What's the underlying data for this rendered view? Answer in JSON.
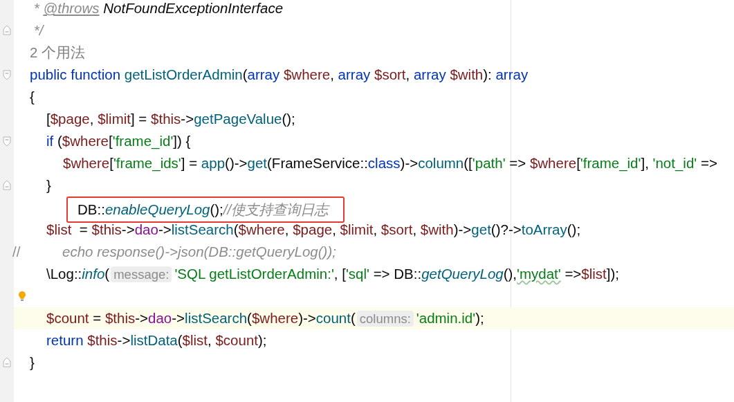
{
  "editor": {
    "lines": [
      {
        "tokens": [
          {
            "kind": "doc",
            "text": " * "
          },
          {
            "kind": "doctag",
            "text": "@throws"
          },
          {
            "kind": "doctype",
            "text": " NotFoundExceptionInterface"
          }
        ]
      },
      {
        "fold_end": true,
        "tokens": [
          {
            "kind": "doc",
            "text": " */"
          }
        ]
      },
      {
        "tokens": [
          {
            "kind": "usage",
            "text": "2 个用法"
          }
        ]
      },
      {
        "fold_start": true,
        "tokens": [
          {
            "kind": "keyword",
            "text": "public function "
          },
          {
            "kind": "function",
            "text": "getListOrderAdmin"
          },
          {
            "kind": "plain",
            "text": "("
          },
          {
            "kind": "keyword",
            "text": "array "
          },
          {
            "kind": "variable",
            "text": "$where"
          },
          {
            "kind": "plain",
            "text": ", "
          },
          {
            "kind": "keyword",
            "text": "array "
          },
          {
            "kind": "variable",
            "text": "$sort"
          },
          {
            "kind": "plain",
            "text": ", "
          },
          {
            "kind": "keyword",
            "text": "array "
          },
          {
            "kind": "variable",
            "text": "$with"
          },
          {
            "kind": "plain",
            "text": "): "
          },
          {
            "kind": "keyword",
            "text": "array"
          }
        ]
      },
      {
        "tokens": [
          {
            "kind": "plain",
            "text": "{"
          }
        ]
      },
      {
        "tokens": [
          {
            "kind": "plain",
            "text": "\t["
          },
          {
            "kind": "variable",
            "text": "$page"
          },
          {
            "kind": "plain",
            "text": ", "
          },
          {
            "kind": "variable",
            "text": "$limit"
          },
          {
            "kind": "plain",
            "text": "] = "
          },
          {
            "kind": "variable",
            "text": "$this"
          },
          {
            "kind": "plain",
            "text": "->"
          },
          {
            "kind": "function",
            "text": "getPageValue"
          },
          {
            "kind": "plain",
            "text": "();"
          }
        ]
      },
      {
        "fold_start": true,
        "tokens": [
          {
            "kind": "keyword",
            "text": "\tif "
          },
          {
            "kind": "plain",
            "text": "("
          },
          {
            "kind": "variable",
            "text": "$where"
          },
          {
            "kind": "plain",
            "text": "["
          },
          {
            "kind": "string",
            "text": "'frame_id'"
          },
          {
            "kind": "plain",
            "text": "]) {"
          }
        ]
      },
      {
        "tokens": [
          {
            "kind": "variable",
            "text": "\t\t$where"
          },
          {
            "kind": "plain",
            "text": "["
          },
          {
            "kind": "string",
            "text": "'frame_ids'"
          },
          {
            "kind": "plain",
            "text": "] = "
          },
          {
            "kind": "function",
            "text": "app"
          },
          {
            "kind": "plain",
            "text": "()->"
          },
          {
            "kind": "function",
            "text": "get"
          },
          {
            "kind": "plain",
            "text": "(FrameService::"
          },
          {
            "kind": "keyword",
            "text": "class"
          },
          {
            "kind": "plain",
            "text": ")->"
          },
          {
            "kind": "function",
            "text": "column"
          },
          {
            "kind": "plain",
            "text": "(["
          },
          {
            "kind": "string",
            "text": "'path'"
          },
          {
            "kind": "plain",
            "text": " => "
          },
          {
            "kind": "variable",
            "text": "$where"
          },
          {
            "kind": "plain",
            "text": "["
          },
          {
            "kind": "string",
            "text": "'frame_id'"
          },
          {
            "kind": "plain",
            "text": "], "
          },
          {
            "kind": "string",
            "text": "'not_id'"
          },
          {
            "kind": "plain",
            "text": " =>"
          }
        ]
      },
      {
        "fold_end": true,
        "tokens": [
          {
            "kind": "plain",
            "text": "\t}"
          }
        ]
      },
      {
        "kind": "boxed",
        "tokens": [
          {
            "kind": "plain",
            "text": "DB::"
          },
          {
            "kind": "static",
            "text": "enableQueryLog"
          },
          {
            "kind": "plain",
            "text": "();"
          },
          {
            "kind": "comment",
            "text": "//使支持查询日志"
          }
        ]
      },
      {
        "tokens": [
          {
            "kind": "variable",
            "text": "\t$list"
          },
          {
            "kind": "plain",
            "text": "  = "
          },
          {
            "kind": "variable",
            "text": "$this"
          },
          {
            "kind": "plain",
            "text": "->"
          },
          {
            "kind": "field",
            "text": "dao"
          },
          {
            "kind": "plain",
            "text": "->"
          },
          {
            "kind": "function",
            "text": "listSearch"
          },
          {
            "kind": "plain",
            "text": "("
          },
          {
            "kind": "variable",
            "text": "$where"
          },
          {
            "kind": "plain",
            "text": ", "
          },
          {
            "kind": "variable",
            "text": "$page"
          },
          {
            "kind": "plain",
            "text": ", "
          },
          {
            "kind": "variable",
            "text": "$limit"
          },
          {
            "kind": "plain",
            "text": ", "
          },
          {
            "kind": "variable",
            "text": "$sort"
          },
          {
            "kind": "plain",
            "text": ", "
          },
          {
            "kind": "variable",
            "text": "$with"
          },
          {
            "kind": "plain",
            "text": ")->"
          },
          {
            "kind": "function",
            "text": "get"
          },
          {
            "kind": "plain",
            "text": "()?->"
          },
          {
            "kind": "function",
            "text": "toArray"
          },
          {
            "kind": "plain",
            "text": "();"
          }
        ]
      },
      {
        "kind": "commented",
        "tokens": [
          {
            "kind": "linecomment",
            "text": "//\t\t\t"
          },
          {
            "kind": "comment",
            "text": "echo response()->json(DB::getQueryLog());"
          }
        ]
      },
      {
        "tokens": [
          {
            "kind": "plain",
            "text": "\t\\Log::"
          },
          {
            "kind": "static",
            "text": "info"
          },
          {
            "kind": "plain",
            "text": "("
          },
          {
            "kind": "hint",
            "text": "message:"
          },
          {
            "kind": "string",
            "text": "'SQL getListOrderAdmin:'"
          },
          {
            "kind": "plain",
            "text": ", ["
          },
          {
            "kind": "string",
            "text": "'sql'"
          },
          {
            "kind": "plain",
            "text": " => DB::"
          },
          {
            "kind": "static",
            "text": "getQueryLog"
          },
          {
            "kind": "plain",
            "text": "(),"
          },
          {
            "kind": "typo",
            "text": "'mydat'"
          },
          {
            "kind": "plain",
            "text": " =>"
          },
          {
            "kind": "variable",
            "text": "$list"
          },
          {
            "kind": "plain",
            "text": "]);"
          }
        ]
      },
      {
        "bulb": true
      },
      {
        "current": true,
        "tokens": [
          {
            "kind": "variable",
            "text": "\t$count"
          },
          {
            "kind": "plain",
            "text": " = "
          },
          {
            "kind": "variable",
            "text": "$this"
          },
          {
            "kind": "plain",
            "text": "->"
          },
          {
            "kind": "field",
            "text": "dao"
          },
          {
            "kind": "plain",
            "text": "->"
          },
          {
            "kind": "function",
            "text": "listSearch"
          },
          {
            "kind": "plain",
            "text": "("
          },
          {
            "kind": "variable",
            "text": "$where"
          },
          {
            "kind": "plain",
            "text": ")->"
          },
          {
            "kind": "function",
            "text": "count"
          },
          {
            "kind": "plain",
            "text": "("
          },
          {
            "kind": "hint",
            "text": "columns:"
          },
          {
            "kind": "string",
            "text": "'admin.id'"
          },
          {
            "kind": "plain",
            "text": ");"
          }
        ]
      },
      {
        "tokens": [
          {
            "kind": "keyword",
            "text": "\treturn "
          },
          {
            "kind": "variable",
            "text": "$this"
          },
          {
            "kind": "plain",
            "text": "->"
          },
          {
            "kind": "function",
            "text": "listData"
          },
          {
            "kind": "plain",
            "text": "("
          },
          {
            "kind": "variable",
            "text": "$list"
          },
          {
            "kind": "plain",
            "text": ", "
          },
          {
            "kind": "variable",
            "text": "$count"
          },
          {
            "kind": "plain",
            "text": ");"
          }
        ]
      },
      {
        "fold_end": true,
        "tokens": [
          {
            "kind": "plain",
            "text": "}"
          }
        ]
      }
    ]
  }
}
